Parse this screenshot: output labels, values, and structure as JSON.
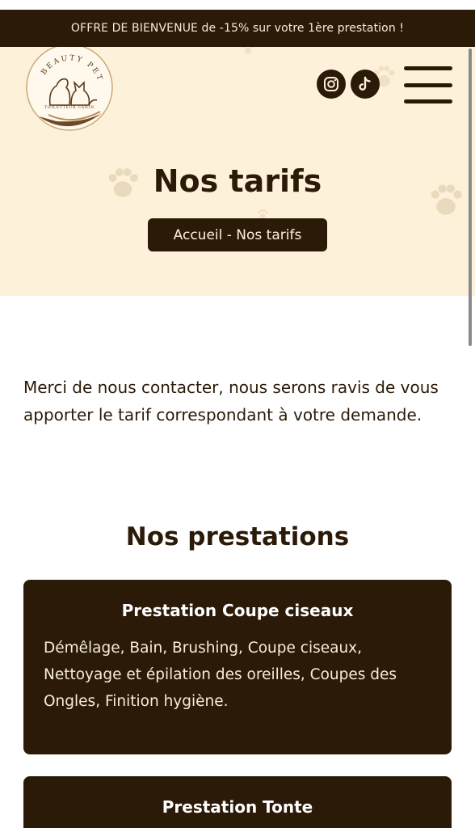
{
  "promo": {
    "text": "OFFRE DE BIENVENUE de -15% sur votre 1ère prestation !"
  },
  "header": {
    "logo_text_top": "BEAUTY PETS",
    "logo_text_bottom": "TOILETTEUR CANIN",
    "social": [
      {
        "icon": "instagram-icon"
      },
      {
        "icon": "tiktok-icon"
      }
    ],
    "menu_icon": "hamburger-menu-icon"
  },
  "hero": {
    "title": "Nos tarifs",
    "breadcrumb": "Accueil - Nos tarifs"
  },
  "main": {
    "intro": "Merci de nous contacter, nous serons ravis de vous apporter le tarif correspondant à votre demande.",
    "section_title": "Nos prestations",
    "services": [
      {
        "title": "Prestation Coupe ciseaux",
        "description": "Démêlage, Bain, Brushing, Coupe ciseaux, Nettoyage et épilation des oreilles, Coupes des Ongles, Finition hygiène."
      },
      {
        "title": "Prestation Tonte",
        "description": ""
      }
    ]
  },
  "colors": {
    "dark_brown": "#2b1a08",
    "cream": "#fdf1d9",
    "white": "#ffffff"
  }
}
